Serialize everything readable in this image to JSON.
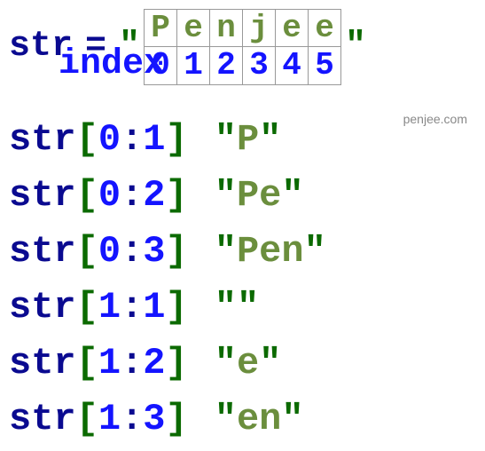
{
  "header": {
    "var_name": "str",
    "equals": "=",
    "quote": "\"",
    "chars": [
      "P",
      "e",
      "n",
      "j",
      "e",
      "e"
    ],
    "indices": [
      "0",
      "1",
      "2",
      "3",
      "4",
      "5"
    ],
    "index_label": "index"
  },
  "watermark": "penjee.com",
  "examples": [
    {
      "var": "str",
      "lbr": "[",
      "a": "0",
      "colon": ":",
      "b": "1",
      "rbr": "]",
      "q": "\"",
      "result": "P"
    },
    {
      "var": "str",
      "lbr": "[",
      "a": "0",
      "colon": ":",
      "b": "2",
      "rbr": "]",
      "q": "\"",
      "result": "Pe"
    },
    {
      "var": "str",
      "lbr": "[",
      "a": "0",
      "colon": ":",
      "b": "3",
      "rbr": "]",
      "q": "\"",
      "result": "Pen"
    },
    {
      "var": "str",
      "lbr": "[",
      "a": "1",
      "colon": ":",
      "b": "1",
      "rbr": "]",
      "q": "\"",
      "result": ""
    },
    {
      "var": "str",
      "lbr": "[",
      "a": "1",
      "colon": ":",
      "b": "2",
      "rbr": "]",
      "q": "\"",
      "result": "e"
    },
    {
      "var": "str",
      "lbr": "[",
      "a": "1",
      "colon": ":",
      "b": "3",
      "rbr": "]",
      "q": "\"",
      "result": "en"
    }
  ]
}
